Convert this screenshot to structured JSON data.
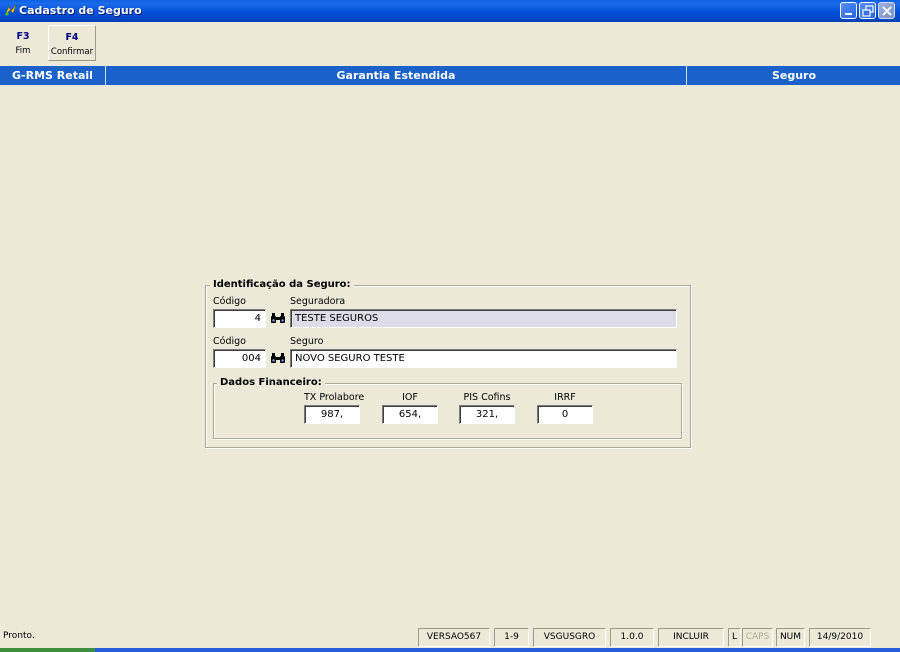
{
  "window": {
    "title": "Cadastro de Seguro"
  },
  "toolbar": {
    "fim": {
      "key": "F3",
      "label": "Fim"
    },
    "confirmar": {
      "key": "F4",
      "label": "Confirmar"
    }
  },
  "header": {
    "left": "G-RMS Retail",
    "center": "Garantia Estendida",
    "right": "Seguro"
  },
  "form": {
    "group_title": "Identificação da Seguro:",
    "seguradora": {
      "code_label": "Código",
      "code_value": "4",
      "name_label": "Seguradora",
      "name_value": "TESTE SEGUROS"
    },
    "seguro": {
      "code_label": "Código",
      "code_value": "004",
      "name_label": "Seguro",
      "name_value": "NOVO SEGURO TESTE"
    },
    "financeiro": {
      "title": "Dados Financeiro:",
      "tx_prolabore": {
        "label": "TX Prolabore",
        "value": "987,"
      },
      "iof": {
        "label": "IOF",
        "value": "654,"
      },
      "pis_cofins": {
        "label": "PIS Cofins",
        "value": "321,"
      },
      "irrf": {
        "label": "IRRF",
        "value": "0"
      }
    }
  },
  "statusbar": {
    "message": "Pronto.",
    "version": "VERSAO567",
    "range": "1-9",
    "program": "VSGUSGRO",
    "release": "1.0.0",
    "mode": "INCLUIR",
    "lock": "L",
    "caps": "CAPS",
    "num": "NUM",
    "date": "14/9/2010"
  },
  "colors": {
    "header_blue": "#1a62c9",
    "background": "#ece9d8",
    "readonly_field": "#dedde7"
  }
}
